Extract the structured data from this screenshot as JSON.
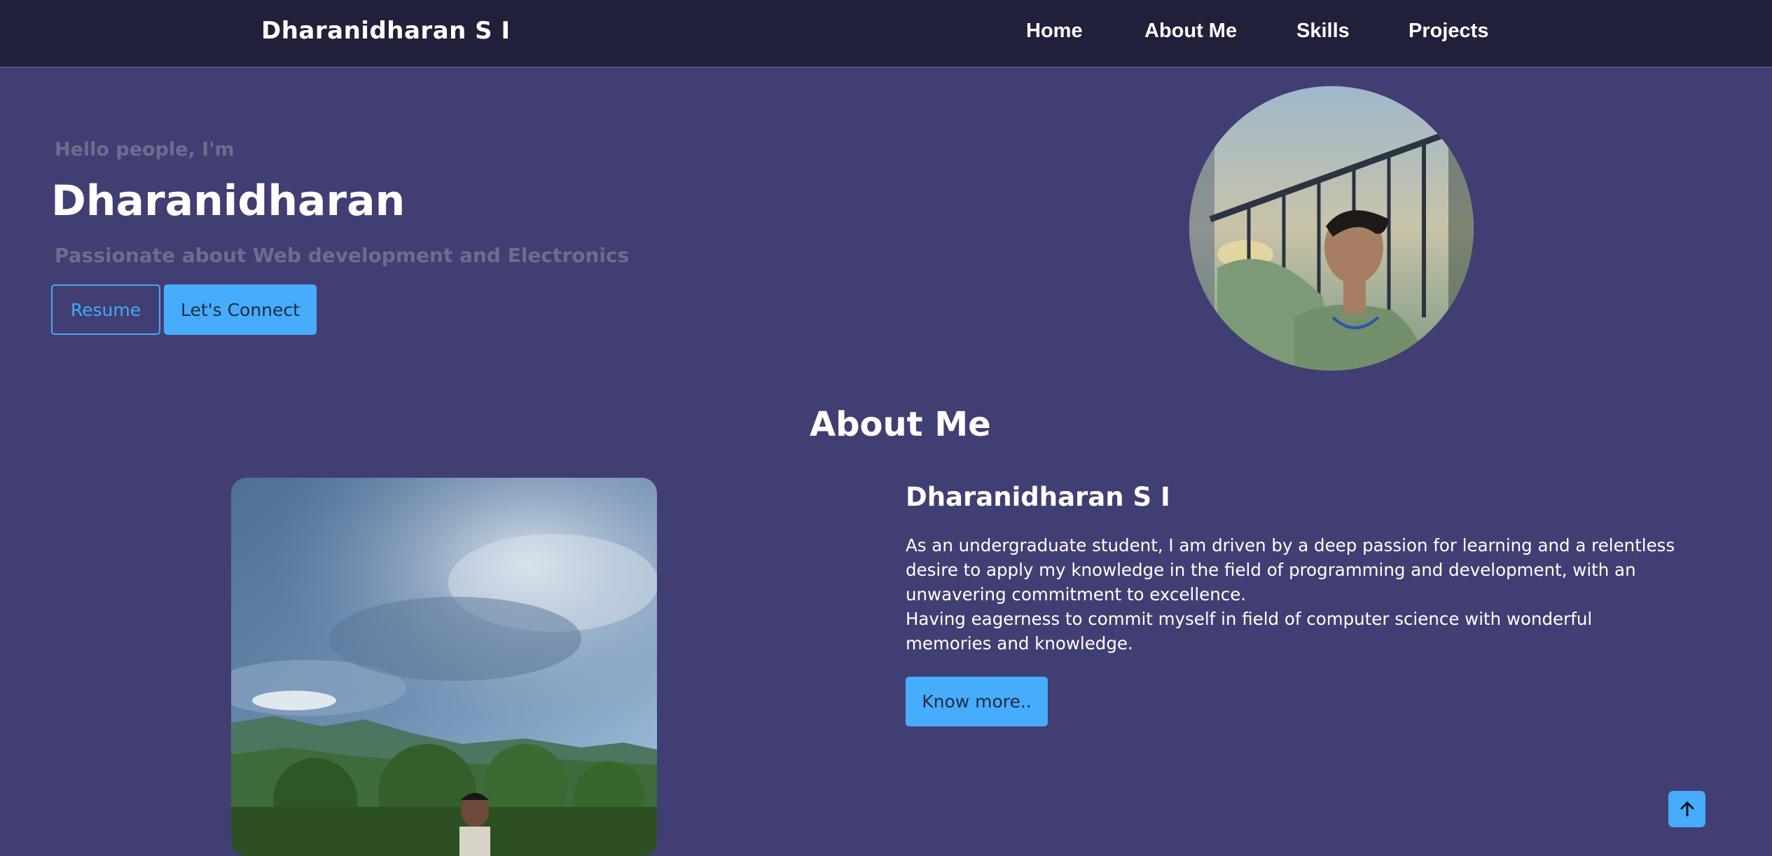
{
  "navbar": {
    "brand": "Dharanidharan S I",
    "links": [
      "Home",
      "About Me",
      "Skills",
      "Projects"
    ]
  },
  "hero": {
    "greeting": "Hello people, I'm",
    "name": "Dharanidharan",
    "tagline": "Passionate about Web development and Electronics",
    "resume_label": "Resume",
    "connect_label": "Let's Connect"
  },
  "about": {
    "title": "About Me",
    "name": "Dharanidharan S I",
    "paragraph1": "As an undergraduate student, I am driven by a deep passion for learning and a relentless desire to apply my knowledge in the field of programming and development, with an unwavering commitment to excellence.",
    "paragraph2": "Having eagerness to commit myself in field of computer science with wonderful memories and knowledge.",
    "know_more_label": "Know more.."
  },
  "colors": {
    "background": "#413e73",
    "navbar": "#20203a",
    "accent": "#47acfb",
    "muted_text": "#6f6c8c"
  },
  "icons": {
    "scroll_top": "arrow-up-icon"
  }
}
